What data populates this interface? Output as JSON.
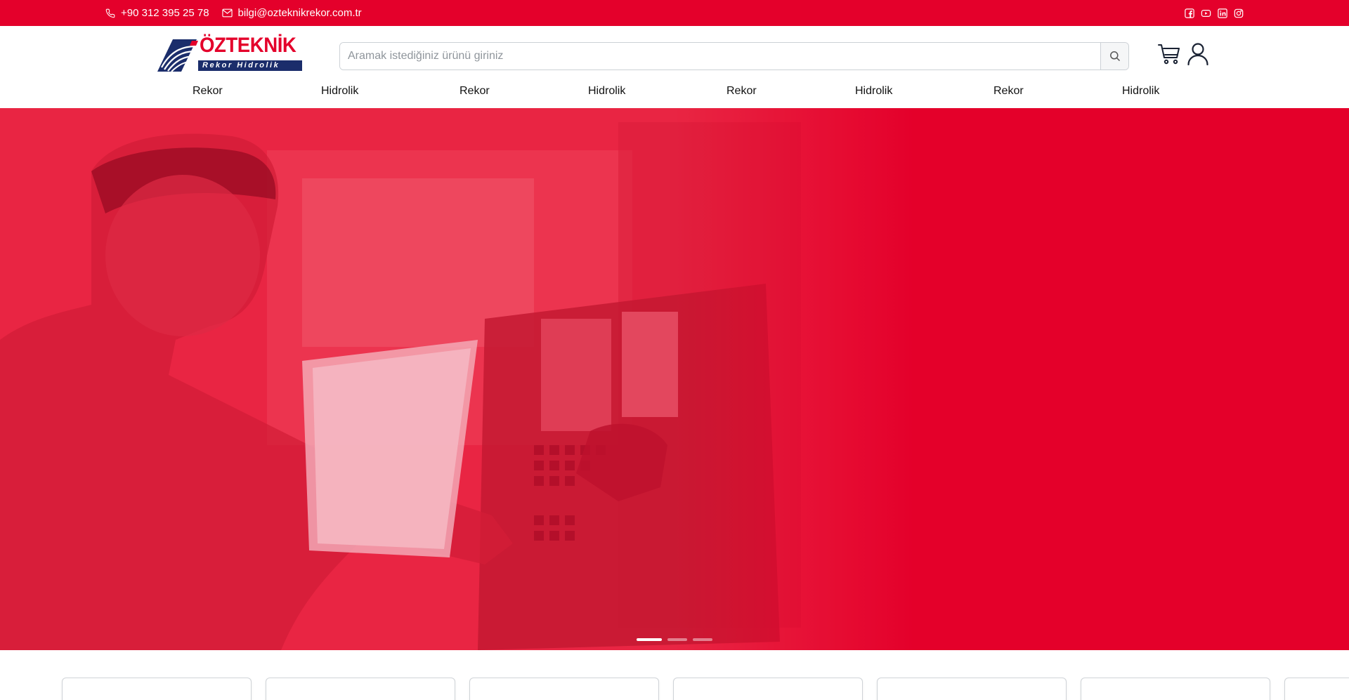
{
  "topbar": {
    "phone": "+90 312 395 25 78",
    "email": "bilgi@ozteknikrekor.com.tr",
    "social_icons": [
      "facebook-icon",
      "youtube-icon",
      "linkedin-icon",
      "instagram-icon"
    ],
    "background_color": "#e4002b"
  },
  "header": {
    "logo": {
      "brand": "ÖZTEKNİK",
      "tagline": "Rekor Hidrolik"
    },
    "search": {
      "placeholder": "Aramak istediğiniz ürünü giriniz",
      "value": ""
    },
    "icons": [
      "search-icon",
      "cart-icon",
      "user-icon"
    ]
  },
  "nav": {
    "items": [
      {
        "label": "Rekor"
      },
      {
        "label": "Hidrolik"
      },
      {
        "label": "Rekor"
      },
      {
        "label": "Hidrolik"
      },
      {
        "label": "Rekor"
      },
      {
        "label": "Hidrolik"
      },
      {
        "label": "Rekor"
      },
      {
        "label": "Hidrolik"
      }
    ]
  },
  "hero": {
    "overlay_color": "#e4002b",
    "slide_count": 3,
    "active_slide": 1
  },
  "colors": {
    "brand_red": "#e4002b",
    "logo_blue": "#1b2d6b"
  }
}
